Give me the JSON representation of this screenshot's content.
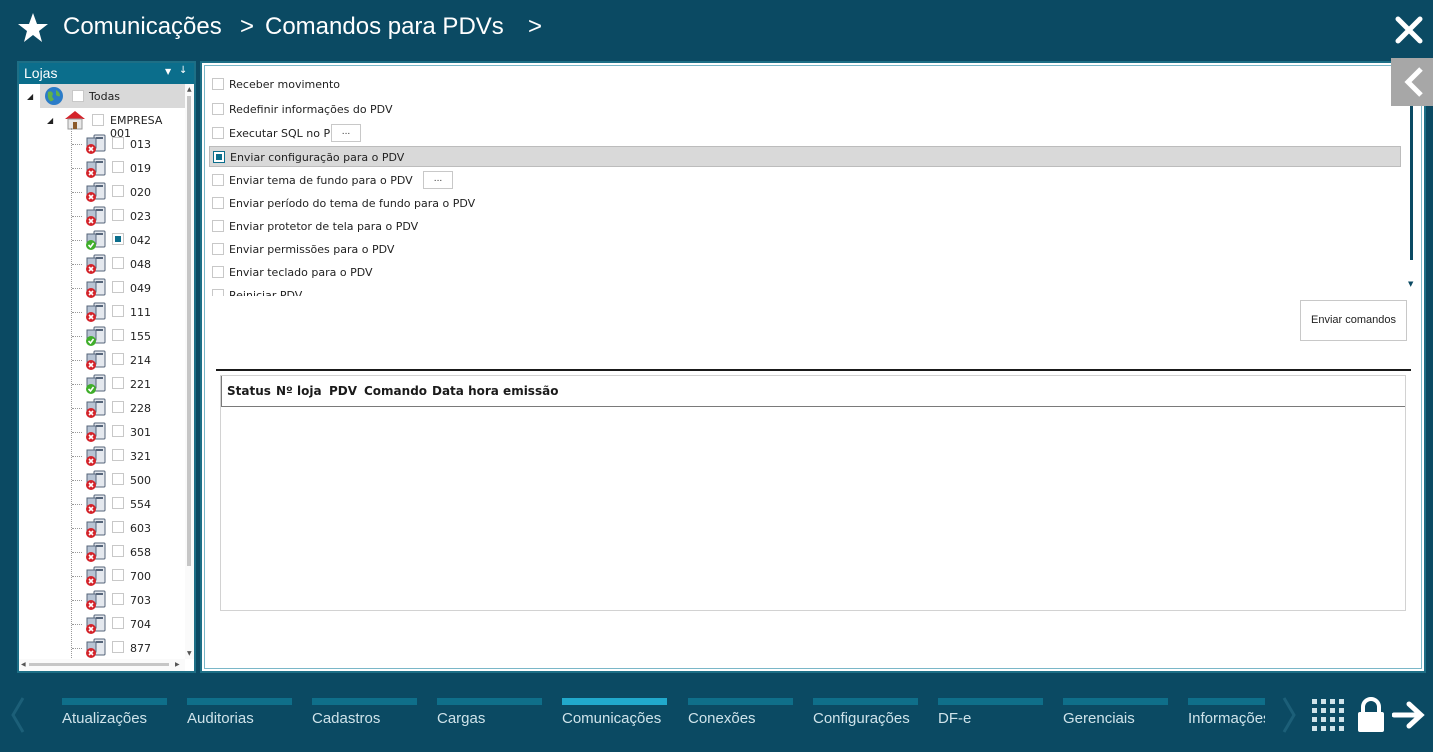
{
  "header": {
    "breadcrumbs": [
      "Comunicações",
      "Comandos para PDVs"
    ],
    "separator": ">"
  },
  "sidebar": {
    "title": "Lojas",
    "root": {
      "label": "Todas",
      "checked": false
    },
    "company": {
      "label": "EMPRESA 001",
      "checked": false
    },
    "stores": [
      {
        "label": "013",
        "status": "offline",
        "checked": false
      },
      {
        "label": "019",
        "status": "offline",
        "checked": false
      },
      {
        "label": "020",
        "status": "offline",
        "checked": false
      },
      {
        "label": "023",
        "status": "offline",
        "checked": false
      },
      {
        "label": "042",
        "status": "online",
        "checked": true
      },
      {
        "label": "048",
        "status": "offline",
        "checked": false
      },
      {
        "label": "049",
        "status": "offline",
        "checked": false
      },
      {
        "label": "111",
        "status": "offline",
        "checked": false
      },
      {
        "label": "155",
        "status": "online",
        "checked": false
      },
      {
        "label": "214",
        "status": "offline",
        "checked": false
      },
      {
        "label": "221",
        "status": "online",
        "checked": false
      },
      {
        "label": "228",
        "status": "offline",
        "checked": false
      },
      {
        "label": "301",
        "status": "offline",
        "checked": false
      },
      {
        "label": "321",
        "status": "offline",
        "checked": false
      },
      {
        "label": "500",
        "status": "offline",
        "checked": false
      },
      {
        "label": "554",
        "status": "offline",
        "checked": false
      },
      {
        "label": "603",
        "status": "offline",
        "checked": false
      },
      {
        "label": "658",
        "status": "offline",
        "checked": false
      },
      {
        "label": "700",
        "status": "offline",
        "checked": false
      },
      {
        "label": "703",
        "status": "offline",
        "checked": false
      },
      {
        "label": "704",
        "status": "offline",
        "checked": false
      },
      {
        "label": "877",
        "status": "offline",
        "checked": false
      }
    ]
  },
  "commands": [
    {
      "label": "Receber movimento",
      "checked": false,
      "selected": false,
      "has_button": false
    },
    {
      "label": "Redefinir informações do PDV",
      "checked": false,
      "selected": false,
      "has_button": false
    },
    {
      "label": "Executar SQL no PDV",
      "checked": false,
      "selected": false,
      "has_button": true
    },
    {
      "label": "Enviar configuração para o PDV",
      "checked": true,
      "selected": true,
      "has_button": false
    },
    {
      "label": "Enviar tema de fundo para o PDV",
      "checked": false,
      "selected": false,
      "has_button": true
    },
    {
      "label": "Enviar período do tema de fundo para o PDV",
      "checked": false,
      "selected": false,
      "has_button": false
    },
    {
      "label": "Enviar protetor de tela para o PDV",
      "checked": false,
      "selected": false,
      "has_button": false
    },
    {
      "label": "Enviar permissões para o PDV",
      "checked": false,
      "selected": false,
      "has_button": false
    },
    {
      "label": "Enviar teclado para o PDV",
      "checked": false,
      "selected": false,
      "has_button": false
    },
    {
      "label": "Reiniciar PDV",
      "checked": false,
      "selected": false,
      "has_button": false
    }
  ],
  "ellipsis_label": "...",
  "send_button": "Enviar comandos",
  "grid": {
    "columns": [
      "Status",
      "Nº loja",
      "PDV",
      "Comando",
      "Data hora emissão"
    ],
    "rows": []
  },
  "bottom_nav": {
    "items": [
      {
        "label": "Atualizações",
        "active": false
      },
      {
        "label": "Auditorias",
        "active": false
      },
      {
        "label": "Cadastros",
        "active": false
      },
      {
        "label": "Cargas",
        "active": false
      },
      {
        "label": "Comunicações",
        "active": true
      },
      {
        "label": "Conexões",
        "active": false
      },
      {
        "label": "Configurações",
        "active": false
      },
      {
        "label": "DF-e",
        "active": false
      },
      {
        "label": "Gerenciais",
        "active": false
      },
      {
        "label": "Informações",
        "active": false
      }
    ]
  },
  "colors": {
    "background": "#0b4a63",
    "accent": "#0b6e8c",
    "active_tab": "#21a9cc",
    "online": "#3fae2a",
    "offline": "#d4232a"
  },
  "icons": {
    "header": "star-icon",
    "close": "close-icon",
    "collapse": "chevron-left-icon",
    "root": "globe-icon",
    "company": "house-icon",
    "store": "pc-status-icon",
    "apps": "grid-icon",
    "lock": "lock-icon",
    "logout": "arrow-right-icon"
  }
}
